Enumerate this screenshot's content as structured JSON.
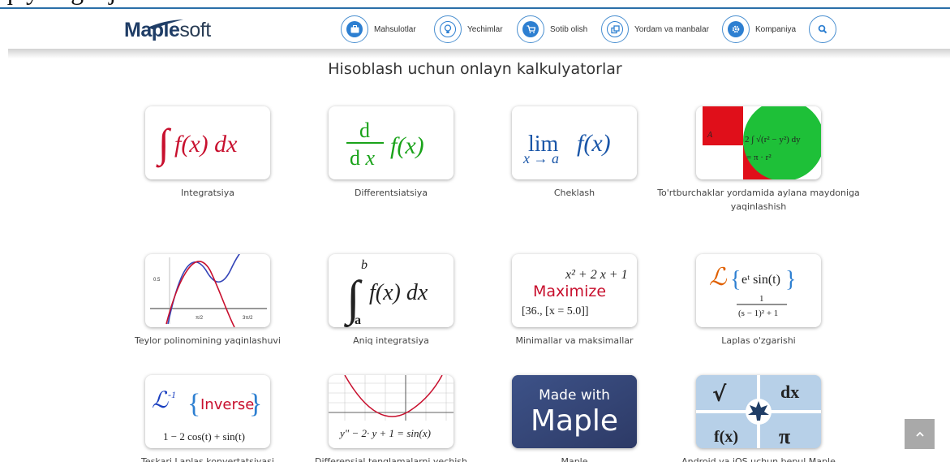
{
  "top_snippet": "quyidagi ajratib turadi:",
  "logo": {
    "brand": "Maple",
    "soft": "soft"
  },
  "nav": {
    "items": [
      {
        "label": "Mahsulotlar",
        "icon": "briefcase-icon"
      },
      {
        "label": "Yechimlar",
        "icon": "lightbulb-icon"
      },
      {
        "label": "Sotib olish",
        "icon": "cart-icon"
      },
      {
        "label": "Yordam va manbalar",
        "icon": "copy-icon"
      },
      {
        "label": "Kompaniya",
        "icon": "gear-icon"
      }
    ],
    "search_icon": "search-icon"
  },
  "page": {
    "title": "Hisoblash uchun onlayn kalkulyatorlar"
  },
  "cards": [
    {
      "caption": "Integratsiya",
      "thumb_text": "f(x) dx"
    },
    {
      "caption": "Differentsiatsiya",
      "thumb_text": "f(x)"
    },
    {
      "caption": "Cheklash",
      "thumb_text": "lim"
    },
    {
      "caption": "To'rtburchaklar yordamida aylana maydoniga yaqinlashish",
      "thumb_text": ""
    },
    {
      "caption": "Teylor polinomining yaqinlashuvi",
      "thumb_text": ""
    },
    {
      "caption": "Aniq integratsiya",
      "thumb_text": "f(x) dx"
    },
    {
      "caption": "Minimallar va maksimallar",
      "thumb_text": "Maximize"
    },
    {
      "caption": "Laplas o'zgarishi",
      "thumb_text": ""
    },
    {
      "caption": "Teskari Laplas konvertatsiyasi",
      "thumb_text": "Inverse"
    },
    {
      "caption": "Differensial tenglamalarni yechish",
      "thumb_text": ""
    },
    {
      "caption": "Maple",
      "thumb_text": "Made with Maple"
    },
    {
      "caption": "Android va iOS uchun bepul Maple",
      "thumb_text": ""
    }
  ],
  "colors": {
    "accent": "#2d7fd1",
    "brand": "#1f3d66",
    "red": "#c8102e",
    "green": "#1aa31a"
  }
}
